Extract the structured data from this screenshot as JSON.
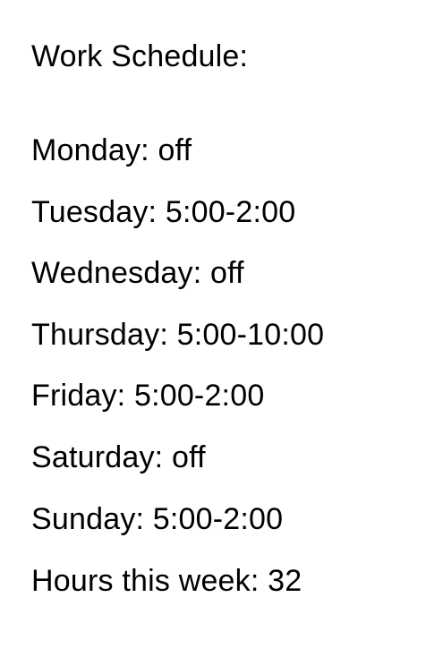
{
  "document": {
    "title": "Work Schedule:",
    "days": [
      {
        "text": "Monday: off"
      },
      {
        "text": "Tuesday: 5:00-2:00"
      },
      {
        "text": "Wednesday: off"
      },
      {
        "text": "Thursday: 5:00-10:00"
      },
      {
        "text": "Friday: 5:00-2:00"
      },
      {
        "text": "Saturday: off"
      },
      {
        "text": "Sunday: 5:00-2:00"
      }
    ],
    "total": "Hours this week: 32"
  }
}
